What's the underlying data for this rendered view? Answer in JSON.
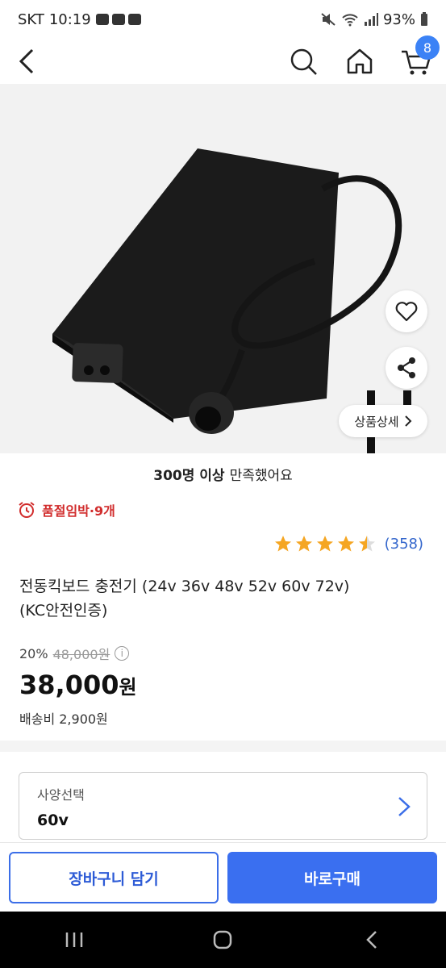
{
  "status_bar": {
    "carrier": "SKT",
    "time": "10:19",
    "battery": "93%"
  },
  "nav": {
    "cart_count": "8"
  },
  "product_image": {
    "detail_button_label": "상품상세"
  },
  "satisfaction": {
    "count_text": "300명 이상",
    "suffix_text": "만족했어요"
  },
  "stock_alert": {
    "text": "품절임박·9개"
  },
  "rating": {
    "stars": 4.5,
    "count": "(358)"
  },
  "product": {
    "title_line1": "전동킥보드 충전기 (24v 36v 48v 52v 60v 72v)",
    "title_line2": "(KC안전인증)"
  },
  "price": {
    "discount": "20%",
    "original": "48,000원",
    "info_icon": "i",
    "sale": "38,000",
    "sale_unit": "원",
    "shipping": "배송비 2,900원"
  },
  "option": {
    "label": "사양선택",
    "value": "60v"
  },
  "actions": {
    "cart": "장바구니 담기",
    "buy": "바로구매"
  },
  "colors": {
    "accent": "#3a6ff0",
    "alert": "#d12c2c",
    "star": "#f5a623",
    "link": "#3366cc"
  }
}
